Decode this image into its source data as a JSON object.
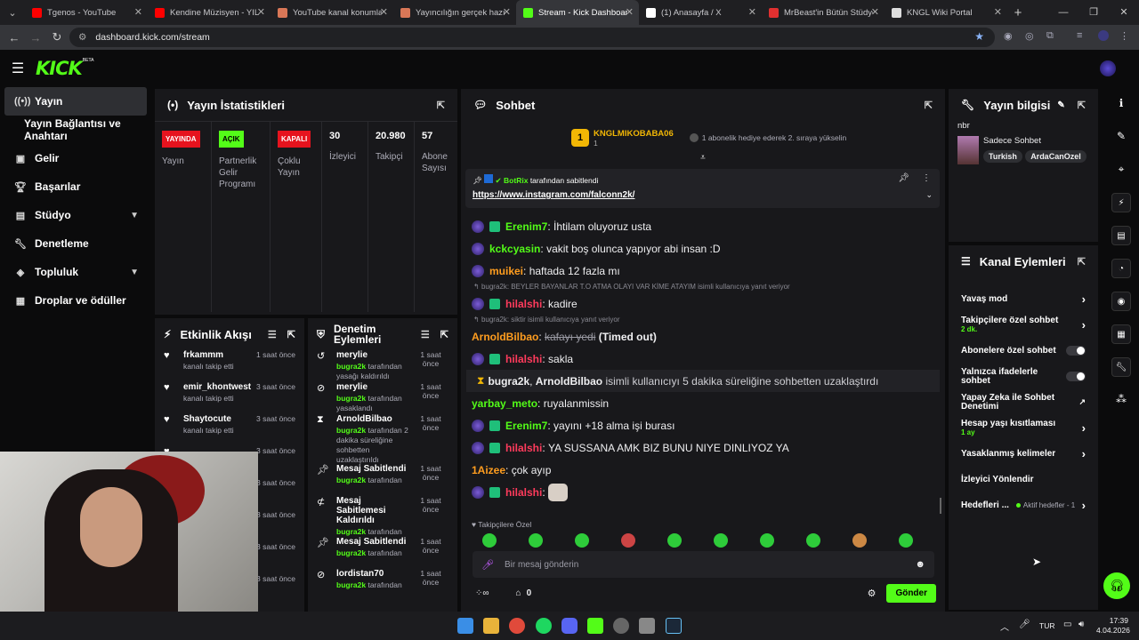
{
  "browser": {
    "tabs": [
      {
        "title": "Tgenos - YouTube",
        "color": "#ff0000"
      },
      {
        "title": "Kendine Müzisyen - YILLA",
        "color": "#ff0000"
      },
      {
        "title": "YouTube kanal konumlar",
        "color": "#d97757"
      },
      {
        "title": "Yayıncılığın gerçek hazırlı",
        "color": "#d97757"
      },
      {
        "title": "Stream - Kick Dashboard",
        "color": "#53fc18",
        "active": true
      },
      {
        "title": "(1) Anasayfa / X",
        "color": "#ffffff"
      },
      {
        "title": "MrBeast'in Bütün Stüdyol",
        "color": "#e03030"
      },
      {
        "title": "KNGL Wiki Portal",
        "color": "#dddddd"
      }
    ],
    "url": "dashboard.kick.com/stream"
  },
  "app": {
    "logo": "KICK",
    "beta": "BETA"
  },
  "sidebar": {
    "items": [
      {
        "label": "Yayın",
        "icon": "broadcast-icon"
      },
      {
        "label": "Yayın Bağlantısı ve Anahtarı"
      },
      {
        "label": "Gelir",
        "icon": "wallet-icon"
      },
      {
        "label": "Başarılar",
        "icon": "trophy-icon"
      },
      {
        "label": "Stüdyo",
        "icon": "studio-icon"
      },
      {
        "label": "Denetleme",
        "icon": "wrench-icon"
      },
      {
        "label": "Topluluk",
        "icon": "community-icon"
      },
      {
        "label": "Droplar ve ödüller",
        "icon": "drops-icon"
      }
    ]
  },
  "stats": {
    "title": "Yayın İstatistikleri",
    "cols": [
      {
        "badge": "YAYINDA",
        "label": "Yayın"
      },
      {
        "badge": "AÇIK",
        "label": "Partnerlik Gelir Programı"
      },
      {
        "badge": "KAPALI",
        "label": "Çoklu Yayın"
      },
      {
        "value": "30",
        "label": "İzleyici"
      },
      {
        "value": "20.980",
        "label": "Takipçi"
      },
      {
        "value": "57",
        "label": "Abone Sayısı"
      }
    ]
  },
  "activity": {
    "title": "Etkinlik Akışı",
    "items": [
      {
        "name": "frkammm",
        "sub": "kanalı takip etti",
        "time": "1 saat önce"
      },
      {
        "name": "emir_khontwest",
        "sub": "kanalı takip etti",
        "time": "3 saat önce"
      },
      {
        "name": "Shaytocute",
        "sub": "kanalı takip etti",
        "time": "3 saat önce"
      },
      {
        "time": "3 saat önce"
      },
      {
        "time": "3 saat önce"
      },
      {
        "time": "3 saat önce"
      },
      {
        "time": "3 saat önce"
      },
      {
        "time": "3 saat önce"
      }
    ]
  },
  "moderation": {
    "title": "Denetim Eylemleri",
    "items": [
      {
        "name": "merylie",
        "who": "bugra2k",
        "rest": "tarafından yasağı kaldırıldı",
        "time": "1 saat önce"
      },
      {
        "name": "merylie",
        "who": "bugra2k",
        "rest": "tarafından yasaklandı",
        "time": "1 saat önce"
      },
      {
        "name": "ArnoldBilbao",
        "who": "bugra2k",
        "rest": "tarafından 2 dakika süreliğine sohbetten uzaklaştırıldı",
        "time": "1 saat önce"
      },
      {
        "name": "Mesaj Sabitlendi",
        "who": "bugra2k",
        "rest": "tarafından",
        "time": "1 saat önce"
      },
      {
        "name": "Mesaj Sabitlemesi Kaldırıldı",
        "who": "bugra2k",
        "rest": "tarafından",
        "time": "1 saat önce"
      },
      {
        "name": "Mesaj Sabitlendi",
        "who": "bugra2k",
        "rest": "tarafından",
        "time": "1 saat önce"
      },
      {
        "name": "lordistan70",
        "who": "bugra2k",
        "rest": "tarafından",
        "time": "1 saat önce"
      }
    ]
  },
  "chat": {
    "title": "Sohbet",
    "topgifter": {
      "name": "KNGLMIKOBABA06",
      "count": "1",
      "rank": "1",
      "hint": "1 abonelik hediye ederek 2. sıraya yükselin"
    },
    "pinned": {
      "by": "BotRix",
      "suffix": "tarafından sabitlendi",
      "link": "https://www.instagram.com/falconn2k/"
    },
    "messages": [
      {
        "user": "Erenim7",
        "color": "#53fc18",
        "text": "İhtilam oluyoruz usta",
        "badges": true
      },
      {
        "user": "kckcyasin",
        "color": "#53fc18",
        "text": "vakit boş olunca yapıyor abi insan :D",
        "badges": "one"
      },
      {
        "user": "muikei",
        "color": "#ff9d1f",
        "text": "haftada 12 fazla mı",
        "badges": "one"
      },
      {
        "reply": "bugra2k: BEYLER BAYANLAR T.O ATMA OLAYI VAR KİME ATAYIM isimli kullanıcıya yanıt veriyor"
      },
      {
        "user": "hilalshi",
        "color": "#ff3b5c",
        "text": "kadire",
        "badges": true
      },
      {
        "reply": "bugra2k: siktir isimli kullanıcıya yanıt veriyor"
      },
      {
        "user": "ArnoldBilbao",
        "color": "#ff9d1f",
        "strike": "kafayı yedi",
        "text": "(Timed out)"
      },
      {
        "user": "hilalshi",
        "color": "#ff3b5c",
        "text": "sakla",
        "badges": true
      },
      {
        "system": true,
        "u1": "bugra2k",
        "u2": "ArnoldBilbao",
        "text": "isimli kullanıcıyı 5 dakika süreliğine sohbetten uzaklaştırdı"
      },
      {
        "user": "yarbay_meto",
        "color": "#53fc18",
        "text": "ruyalanmissin"
      },
      {
        "user": "Erenim7",
        "color": "#53fc18",
        "text": "yayını +18 alma işi burası",
        "badges": true
      },
      {
        "user": "hilalshi",
        "color": "#ff3b5c",
        "text": "YA SUSSANA AMK BIZ BUNU NIYE DINLIYOZ YA",
        "badges": true
      },
      {
        "user": "1Aizee",
        "color": "#ff9d1f",
        "text": "çok ayıp"
      },
      {
        "user": "hilalshi",
        "color": "#ff3b5c",
        "text": "",
        "badges": true,
        "emote": true
      }
    ],
    "emote_label": "Takipçilere Özel",
    "input_placeholder": "Bir mesaj gönderin",
    "points": "0",
    "send": "Gönder"
  },
  "info": {
    "title": "Yayın bilgisi",
    "stream_title": "nbr",
    "category": "Sadece Sohbet",
    "tags": [
      "Turkish",
      "ArdaCanOzel"
    ]
  },
  "actions": {
    "title": "Kanal Eylemleri",
    "items": [
      {
        "label": "Yavaş mod",
        "type": "chev"
      },
      {
        "label": "Takipçilere özel sohbet",
        "sub": "2 dk.",
        "type": "chev"
      },
      {
        "label": "Abonelere özel sohbet",
        "type": "toggle"
      },
      {
        "label": "Yalnızca ifadelerle sohbet",
        "type": "toggle"
      },
      {
        "label": "Yapay Zeka ile Sohbet Denetimi",
        "type": "ext"
      },
      {
        "label": "Hesap yaşı kısıtlaması",
        "sub": "1 ay",
        "type": "chev"
      },
      {
        "label": "Yasaklanmış kelimeler",
        "type": "chev"
      },
      {
        "label": "İzleyici Yönlendir",
        "type": "none"
      },
      {
        "label": "Hedefleri ...",
        "extra": "Aktif hedefler - 1",
        "type": "chev"
      }
    ]
  },
  "taskbar": {
    "lang": "TUR",
    "time": "17:39",
    "date": "4.04.2026"
  }
}
